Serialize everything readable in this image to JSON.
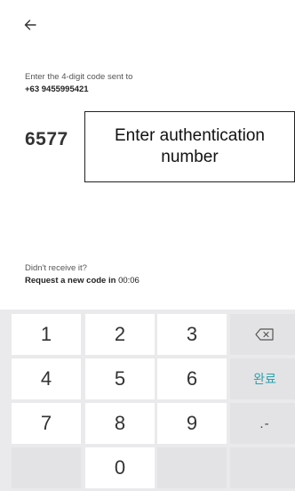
{
  "header": {
    "back_icon": "back-arrow-icon"
  },
  "verification": {
    "prompt": "Enter the 4-digit code sent to",
    "phone": "+63 9455995421",
    "code": "6577",
    "annotation": "Enter authentication number"
  },
  "resend": {
    "question": "Didn't receive it?",
    "prefix": "Request a new code in ",
    "timer": "00:06"
  },
  "keypad": {
    "keys": [
      "1",
      "2",
      "3",
      "4",
      "5",
      "6",
      "7",
      "8",
      "9",
      "",
      "0",
      ""
    ],
    "backspace_icon": "backspace-icon",
    "done_label": "완료",
    "punct_label": ".-"
  }
}
